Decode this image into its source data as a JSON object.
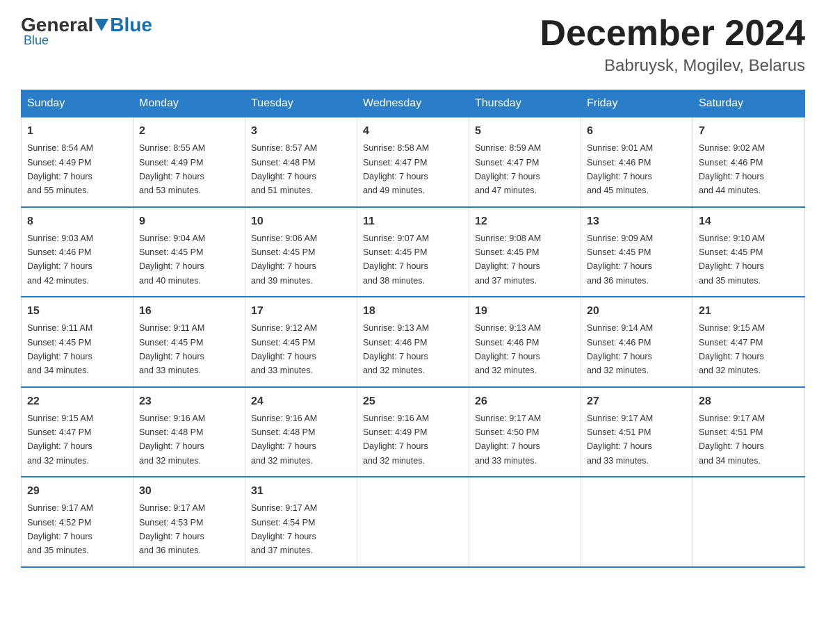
{
  "header": {
    "logo": {
      "general": "General",
      "blue": "Blue"
    },
    "month_title": "December 2024",
    "location": "Babruysk, Mogilev, Belarus"
  },
  "weekdays": [
    "Sunday",
    "Monday",
    "Tuesday",
    "Wednesday",
    "Thursday",
    "Friday",
    "Saturday"
  ],
  "weeks": [
    [
      {
        "day": "1",
        "info": "Sunrise: 8:54 AM\nSunset: 4:49 PM\nDaylight: 7 hours\nand 55 minutes."
      },
      {
        "day": "2",
        "info": "Sunrise: 8:55 AM\nSunset: 4:49 PM\nDaylight: 7 hours\nand 53 minutes."
      },
      {
        "day": "3",
        "info": "Sunrise: 8:57 AM\nSunset: 4:48 PM\nDaylight: 7 hours\nand 51 minutes."
      },
      {
        "day": "4",
        "info": "Sunrise: 8:58 AM\nSunset: 4:47 PM\nDaylight: 7 hours\nand 49 minutes."
      },
      {
        "day": "5",
        "info": "Sunrise: 8:59 AM\nSunset: 4:47 PM\nDaylight: 7 hours\nand 47 minutes."
      },
      {
        "day": "6",
        "info": "Sunrise: 9:01 AM\nSunset: 4:46 PM\nDaylight: 7 hours\nand 45 minutes."
      },
      {
        "day": "7",
        "info": "Sunrise: 9:02 AM\nSunset: 4:46 PM\nDaylight: 7 hours\nand 44 minutes."
      }
    ],
    [
      {
        "day": "8",
        "info": "Sunrise: 9:03 AM\nSunset: 4:46 PM\nDaylight: 7 hours\nand 42 minutes."
      },
      {
        "day": "9",
        "info": "Sunrise: 9:04 AM\nSunset: 4:45 PM\nDaylight: 7 hours\nand 40 minutes."
      },
      {
        "day": "10",
        "info": "Sunrise: 9:06 AM\nSunset: 4:45 PM\nDaylight: 7 hours\nand 39 minutes."
      },
      {
        "day": "11",
        "info": "Sunrise: 9:07 AM\nSunset: 4:45 PM\nDaylight: 7 hours\nand 38 minutes."
      },
      {
        "day": "12",
        "info": "Sunrise: 9:08 AM\nSunset: 4:45 PM\nDaylight: 7 hours\nand 37 minutes."
      },
      {
        "day": "13",
        "info": "Sunrise: 9:09 AM\nSunset: 4:45 PM\nDaylight: 7 hours\nand 36 minutes."
      },
      {
        "day": "14",
        "info": "Sunrise: 9:10 AM\nSunset: 4:45 PM\nDaylight: 7 hours\nand 35 minutes."
      }
    ],
    [
      {
        "day": "15",
        "info": "Sunrise: 9:11 AM\nSunset: 4:45 PM\nDaylight: 7 hours\nand 34 minutes."
      },
      {
        "day": "16",
        "info": "Sunrise: 9:11 AM\nSunset: 4:45 PM\nDaylight: 7 hours\nand 33 minutes."
      },
      {
        "day": "17",
        "info": "Sunrise: 9:12 AM\nSunset: 4:45 PM\nDaylight: 7 hours\nand 33 minutes."
      },
      {
        "day": "18",
        "info": "Sunrise: 9:13 AM\nSunset: 4:46 PM\nDaylight: 7 hours\nand 32 minutes."
      },
      {
        "day": "19",
        "info": "Sunrise: 9:13 AM\nSunset: 4:46 PM\nDaylight: 7 hours\nand 32 minutes."
      },
      {
        "day": "20",
        "info": "Sunrise: 9:14 AM\nSunset: 4:46 PM\nDaylight: 7 hours\nand 32 minutes."
      },
      {
        "day": "21",
        "info": "Sunrise: 9:15 AM\nSunset: 4:47 PM\nDaylight: 7 hours\nand 32 minutes."
      }
    ],
    [
      {
        "day": "22",
        "info": "Sunrise: 9:15 AM\nSunset: 4:47 PM\nDaylight: 7 hours\nand 32 minutes."
      },
      {
        "day": "23",
        "info": "Sunrise: 9:16 AM\nSunset: 4:48 PM\nDaylight: 7 hours\nand 32 minutes."
      },
      {
        "day": "24",
        "info": "Sunrise: 9:16 AM\nSunset: 4:48 PM\nDaylight: 7 hours\nand 32 minutes."
      },
      {
        "day": "25",
        "info": "Sunrise: 9:16 AM\nSunset: 4:49 PM\nDaylight: 7 hours\nand 32 minutes."
      },
      {
        "day": "26",
        "info": "Sunrise: 9:17 AM\nSunset: 4:50 PM\nDaylight: 7 hours\nand 33 minutes."
      },
      {
        "day": "27",
        "info": "Sunrise: 9:17 AM\nSunset: 4:51 PM\nDaylight: 7 hours\nand 33 minutes."
      },
      {
        "day": "28",
        "info": "Sunrise: 9:17 AM\nSunset: 4:51 PM\nDaylight: 7 hours\nand 34 minutes."
      }
    ],
    [
      {
        "day": "29",
        "info": "Sunrise: 9:17 AM\nSunset: 4:52 PM\nDaylight: 7 hours\nand 35 minutes."
      },
      {
        "day": "30",
        "info": "Sunrise: 9:17 AM\nSunset: 4:53 PM\nDaylight: 7 hours\nand 36 minutes."
      },
      {
        "day": "31",
        "info": "Sunrise: 9:17 AM\nSunset: 4:54 PM\nDaylight: 7 hours\nand 37 minutes."
      },
      {
        "day": "",
        "info": ""
      },
      {
        "day": "",
        "info": ""
      },
      {
        "day": "",
        "info": ""
      },
      {
        "day": "",
        "info": ""
      }
    ]
  ]
}
